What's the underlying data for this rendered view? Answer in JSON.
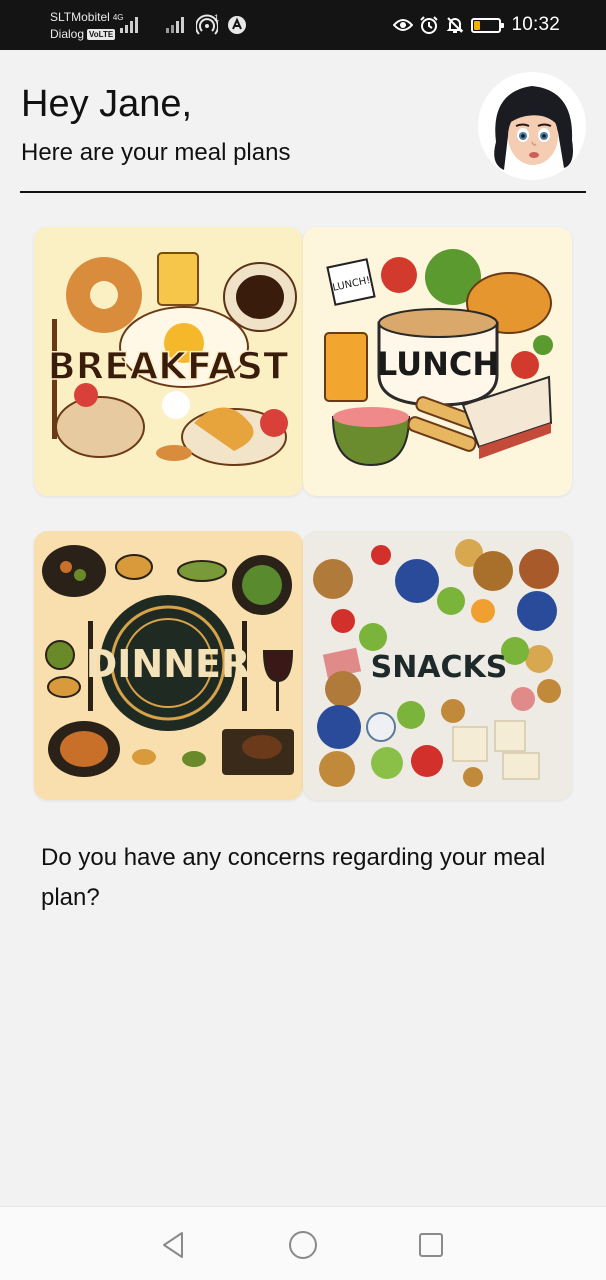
{
  "status_bar": {
    "carrier_1": "SLTMobitel",
    "carrier_1_network": "4G",
    "carrier_2": "Dialog",
    "carrier_2_badge": "VoLTE",
    "hotspot_count": "1",
    "time": "10:32",
    "battery_level": 0.25,
    "icons": [
      "signal-icon",
      "hotspot-icon",
      "app-notification-icon",
      "eye-comfort-icon",
      "alarm-icon",
      "mute-bell-icon",
      "battery-icon"
    ]
  },
  "header": {
    "greeting": "Hey Jane,",
    "subtitle": "Here are your meal plans"
  },
  "meals": {
    "breakfast": {
      "label": "BREAKFAST"
    },
    "lunch": {
      "label": "LUNCH",
      "tag": "LUNCH!"
    },
    "dinner": {
      "label": "DINNER"
    },
    "snacks": {
      "label": "SNACKS"
    }
  },
  "concern_text": "Do you have any concerns regarding your meal plan?",
  "nav": {
    "icons": [
      "back-icon",
      "home-icon",
      "recents-icon"
    ]
  },
  "colors": {
    "background": "#f2f2f2",
    "status_bar": "#141414",
    "battery_low": "#f0b400",
    "text": "#111111"
  }
}
